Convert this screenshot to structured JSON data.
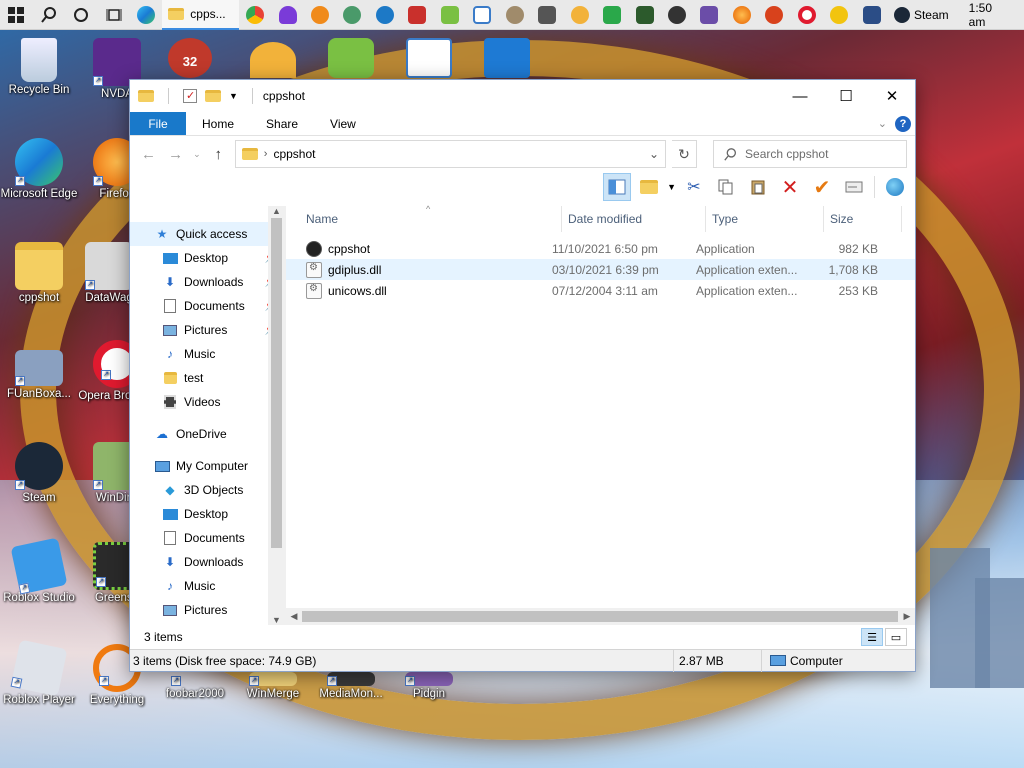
{
  "taskbar": {
    "active_label": "cpps...",
    "steam_label": "Steam",
    "clock": "1:50 am"
  },
  "desktop_icons": [
    {
      "label": "Recycle Bin"
    },
    {
      "label": "NVDA"
    },
    {
      "label": "Microsoft Edge"
    },
    {
      "label": "Firefox"
    },
    {
      "label": "cppshot"
    },
    {
      "label": "DataWag"
    },
    {
      "label": "FUanBoxa..."
    },
    {
      "label": "Opera Browser"
    },
    {
      "label": "Steam"
    },
    {
      "label": "WinDirS"
    },
    {
      "label": "Roblox Studio"
    },
    {
      "label": "Greensh"
    },
    {
      "label": "Roblox Player"
    },
    {
      "label": "Everything"
    },
    {
      "label": "foobar2000"
    },
    {
      "label": "WinMerge"
    },
    {
      "label": "MediaMon..."
    },
    {
      "label": "Pidgin"
    }
  ],
  "badge_32": "32",
  "window": {
    "title": "cppshot",
    "tabs": [
      "File",
      "Home",
      "Share",
      "View"
    ],
    "address_crumb": "cppshot",
    "search_placeholder": "Search cppshot",
    "nav": {
      "quick_access": "Quick access",
      "quick_items": [
        {
          "label": "Desktop",
          "pinned": true
        },
        {
          "label": "Downloads",
          "pinned": true
        },
        {
          "label": "Documents",
          "pinned": true
        },
        {
          "label": "Pictures",
          "pinned": true
        },
        {
          "label": "Music",
          "pinned": false
        },
        {
          "label": "test",
          "pinned": false
        },
        {
          "label": "Videos",
          "pinned": false
        }
      ],
      "onedrive": "OneDrive",
      "my_computer": "My Computer",
      "computer_items": [
        "3D Objects",
        "Desktop",
        "Documents",
        "Downloads",
        "Music",
        "Pictures"
      ]
    },
    "columns": {
      "name": "Name",
      "date": "Date modified",
      "type": "Type",
      "size": "Size"
    },
    "files": [
      {
        "name": "cppshot",
        "date": "11/10/2021 6:50 pm",
        "type": "Application",
        "size": "982 KB"
      },
      {
        "name": "gdiplus.dll",
        "date": "03/10/2021 6:39 pm",
        "type": "Application exten...",
        "size": "1,708 KB"
      },
      {
        "name": "unicows.dll",
        "date": "07/12/2004 3:11 am",
        "type": "Application exten...",
        "size": "253 KB"
      }
    ],
    "status_items": "3 items",
    "bottom": {
      "info": "3 items (Disk free space: 74.9 GB)",
      "size": "2.87 MB",
      "location": "Computer"
    }
  }
}
